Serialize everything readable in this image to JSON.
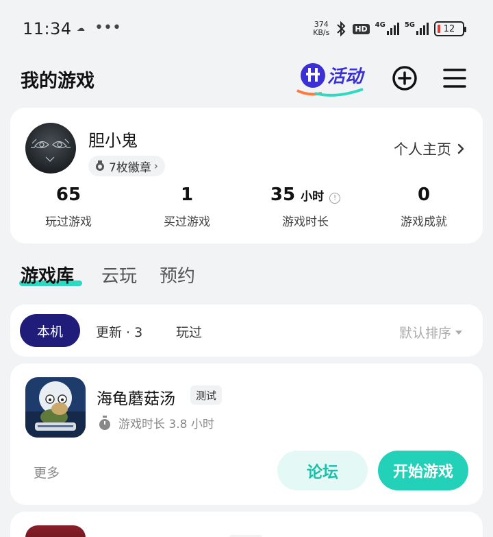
{
  "status_bar": {
    "time": "11:34",
    "more_dots": "•••",
    "net_speed_value": "374",
    "net_speed_unit": "KB/s",
    "hd_label": "HD",
    "net1": "4G",
    "net2": "5G",
    "battery_level": "12",
    "battery_color": "#e53935"
  },
  "header": {
    "title": "我的游戏",
    "activity_label": "活动"
  },
  "profile": {
    "username": "胆小鬼",
    "badges": "7枚徽章",
    "profile_link": "个人主页",
    "stats": [
      {
        "value": "65",
        "unit": "",
        "label": "玩过游戏"
      },
      {
        "value": "1",
        "unit": "",
        "label": "买过游戏"
      },
      {
        "value": "35",
        "unit": "小时",
        "label": "游戏时长"
      },
      {
        "value": "0",
        "unit": "",
        "label": "游戏成就"
      }
    ]
  },
  "main_tabs": [
    {
      "label": "游戏库",
      "active": true
    },
    {
      "label": "云玩",
      "active": false
    },
    {
      "label": "预约",
      "active": false
    }
  ],
  "filters": {
    "chips": [
      "本机",
      "更新 · 3",
      "玩过"
    ],
    "active": "本机",
    "sort_label": "默认排序"
  },
  "game": {
    "title": "海龟蘑菇汤",
    "tag": "测试",
    "playtime": "游戏时长 3.8 小时",
    "more_label": "更多",
    "forum_label": "论坛",
    "start_label": "开始游戏"
  },
  "colors": {
    "accent": "#22d1b8",
    "active_chip": "#1f1c7a",
    "background": "#f2f3f5"
  }
}
